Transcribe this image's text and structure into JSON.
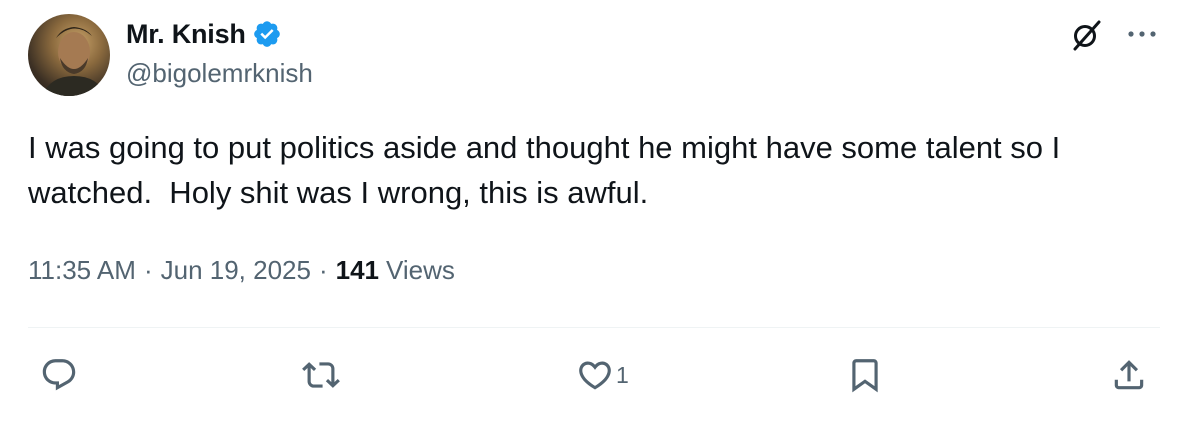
{
  "user": {
    "display_name": "Mr. Knish",
    "handle": "@bigolemrknish",
    "verified": true
  },
  "tweet": {
    "text": "I was going to put politics aside and thought he might have some talent so I watched.  Holy shit was I wrong, this is awful.",
    "time": "11:35 AM",
    "date": "Jun 19, 2025",
    "separator": "·",
    "views_count": "141",
    "views_label": "Views"
  },
  "actions": {
    "reply_icon": "reply-icon",
    "retweet_icon": "retweet-icon",
    "like_icon": "heart-icon",
    "like_count": "1",
    "bookmark_icon": "bookmark-icon",
    "share_icon": "share-icon"
  },
  "header_icons": {
    "grok": "grok-icon",
    "more": "more-icon"
  },
  "colors": {
    "text": "#0f1419",
    "secondary": "#536471",
    "verified": "#1d9bf0",
    "divider": "#eff3f4"
  }
}
